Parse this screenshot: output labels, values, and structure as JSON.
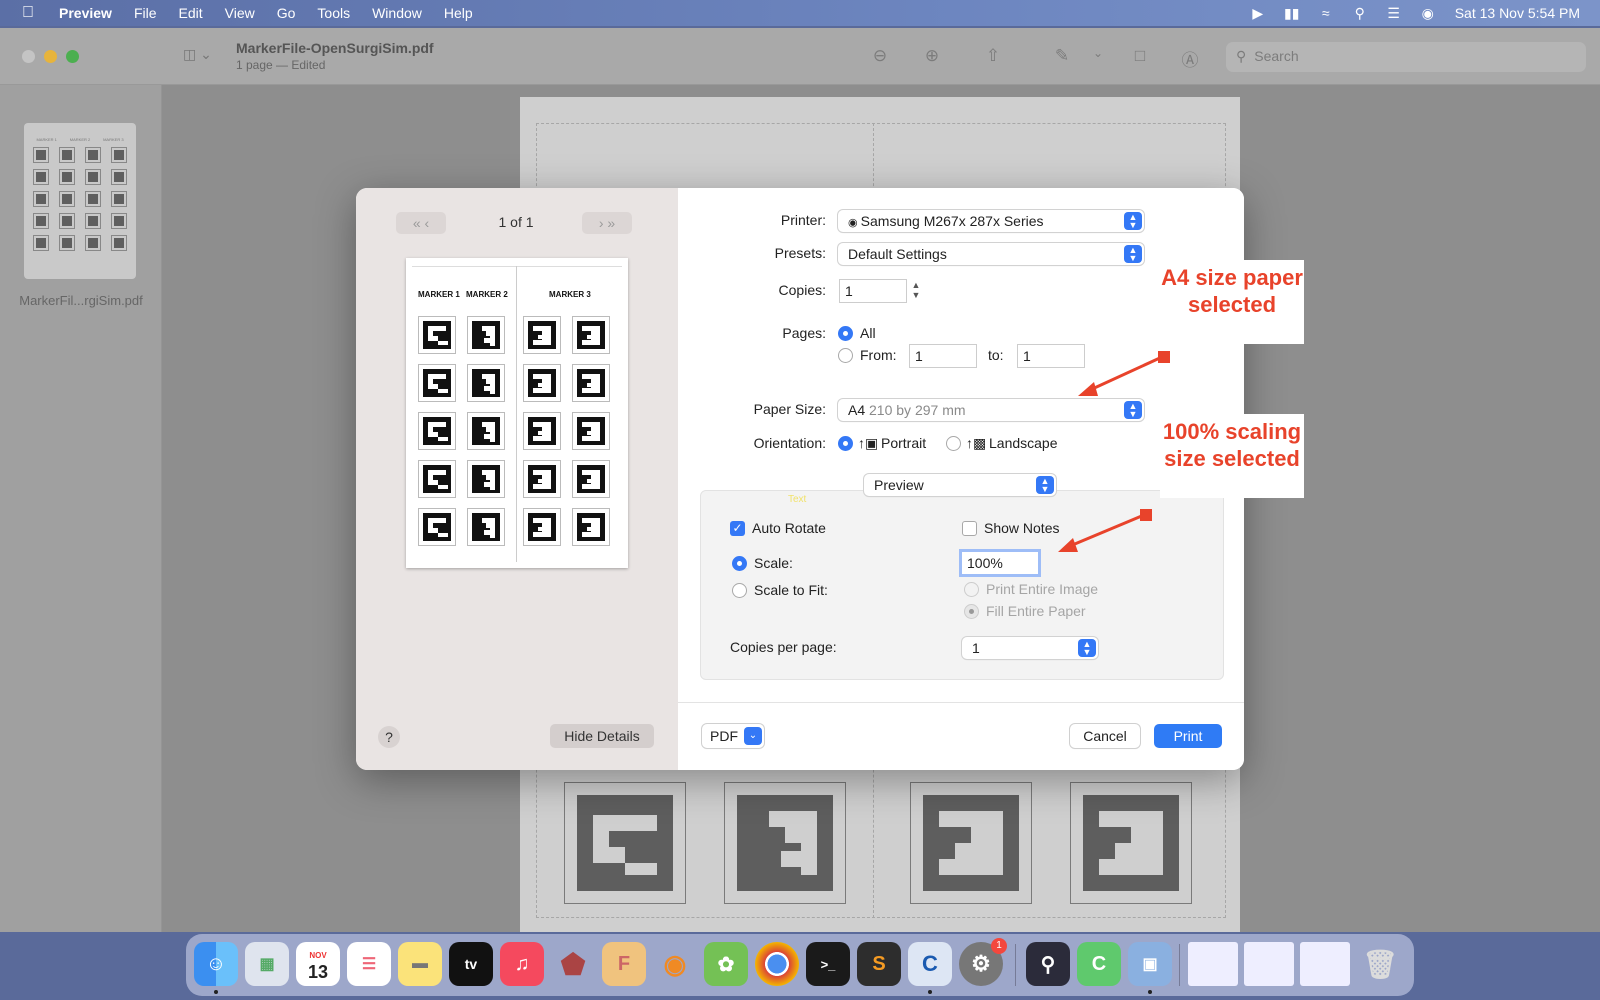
{
  "menubar": {
    "apple_icon": "apple-logo",
    "app_name": "Preview",
    "menus": [
      "File",
      "Edit",
      "View",
      "Go",
      "Tools",
      "Window",
      "Help"
    ],
    "clock": "Sat 13 Nov  5:54 PM"
  },
  "window": {
    "doc_title": "MarkerFile-OpenSurgiSim.pdf",
    "doc_subtitle": "1 page — Edited",
    "search_placeholder": "Search",
    "thumbnail_label": "MarkerFil...rgiSim.pdf",
    "thumbnail_headers": [
      "MARKER 1",
      "MARKER 2",
      "MARKER 3"
    ]
  },
  "print_dialog": {
    "page_indicator": "1 of 1",
    "preview_headers": [
      "MARKER 1",
      "MARKER 2",
      "MARKER 3"
    ],
    "help_label": "?",
    "hide_details_label": "Hide Details",
    "printer_label": "Printer:",
    "printer_value": "Samsung M267x 287x Series",
    "presets_label": "Presets:",
    "presets_value": "Default Settings",
    "copies_label": "Copies:",
    "copies_value": "1",
    "pages_label": "Pages:",
    "pages_all": "All",
    "pages_from": "From:",
    "pages_from_value": "1",
    "pages_to": "to:",
    "pages_to_value": "1",
    "paper_size_label": "Paper Size:",
    "paper_size_value": "A4",
    "paper_size_detail": "210 by 297 mm",
    "orientation_label": "Orientation:",
    "orientation_portrait": "Portrait",
    "orientation_landscape": "Landscape",
    "section_value": "Preview",
    "faint_text": "Text",
    "auto_rotate": "Auto Rotate",
    "show_notes": "Show Notes",
    "scale_label": "Scale:",
    "scale_value": "100%",
    "scale_to_fit": "Scale to Fit:",
    "print_entire_image": "Print Entire Image",
    "fill_entire_paper": "Fill Entire Paper",
    "copies_per_page_label": "Copies per page:",
    "copies_per_page_value": "1",
    "pdf_label": "PDF",
    "cancel_label": "Cancel",
    "print_label": "Print"
  },
  "annotations": {
    "paper_note": "A4 size paper selected",
    "scale_note": "100% scaling size selected",
    "color": "#e8432b"
  },
  "dock": {
    "calendar_month": "NOV",
    "calendar_day": "13",
    "tv_label": "tv",
    "badge": "1"
  }
}
